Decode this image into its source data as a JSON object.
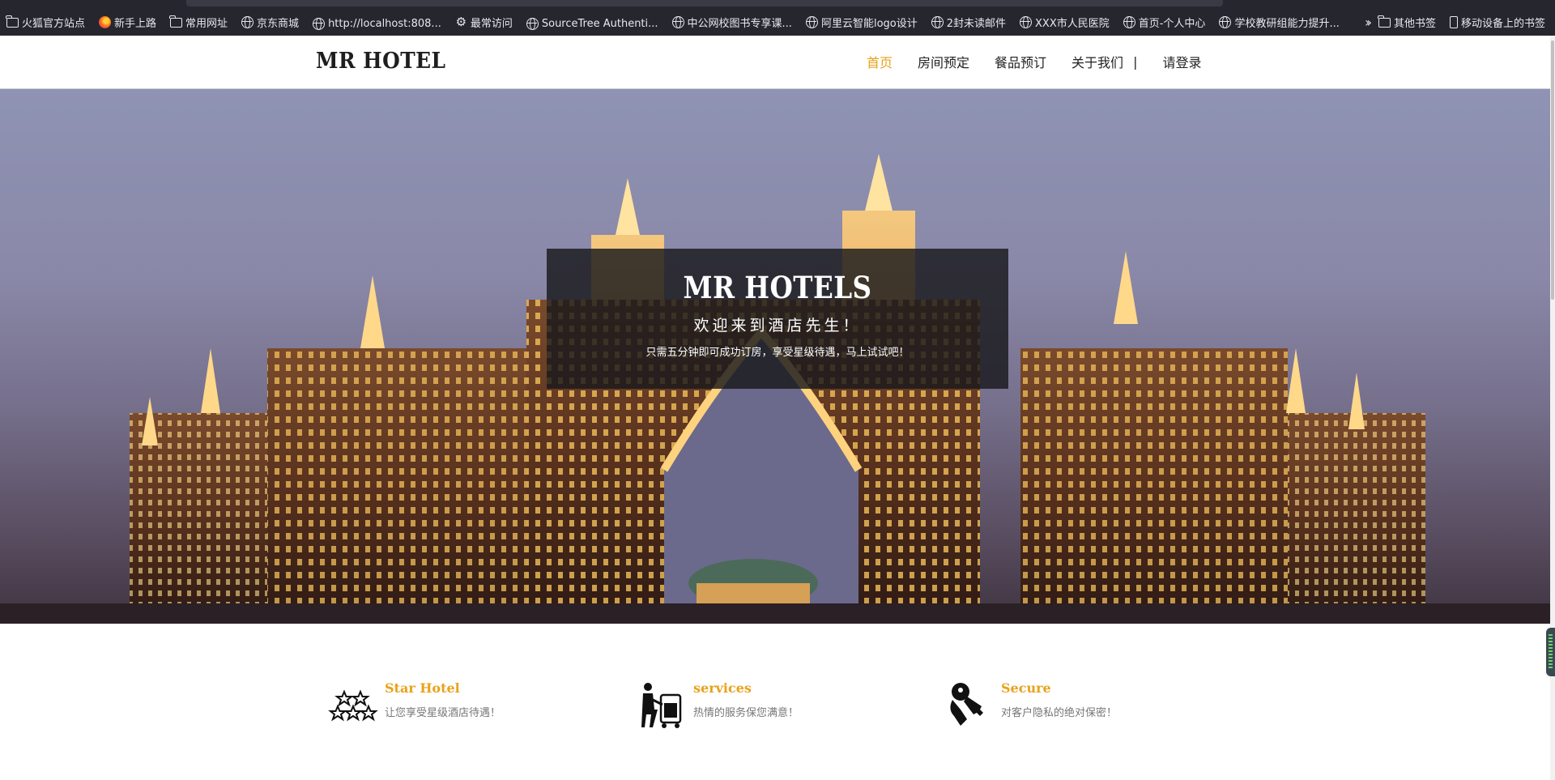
{
  "browser": {
    "bookmarks": [
      {
        "label": "火狐官方站点",
        "icon": "folder-icon"
      },
      {
        "label": "新手上路",
        "icon": "firefox-icon"
      },
      {
        "label": "常用网址",
        "icon": "folder-icon"
      },
      {
        "label": "京东商城",
        "icon": "globe-icon"
      },
      {
        "label": "http://localhost:808...",
        "icon": "globe-icon"
      },
      {
        "label": "最常访问",
        "icon": "gear-icon"
      },
      {
        "label": "SourceTree Authenti...",
        "icon": "globe-icon"
      },
      {
        "label": "中公网校图书专享课...",
        "icon": "globe-icon"
      },
      {
        "label": "阿里云智能logo设计",
        "icon": "globe-icon"
      },
      {
        "label": "2封未读邮件",
        "icon": "globe-icon"
      },
      {
        "label": "XXX市人民医院",
        "icon": "globe-icon"
      },
      {
        "label": "首页-个人中心",
        "icon": "globe-icon"
      },
      {
        "label": "学校教研组能力提升...",
        "icon": "globe-icon"
      }
    ],
    "other_bookmarks": "其他书签",
    "mobile_bookmarks": "移动设备上的书签"
  },
  "header": {
    "logo": "MR HOTEL",
    "nav": [
      {
        "label": "首页",
        "active": true
      },
      {
        "label": "房间预定",
        "active": false
      },
      {
        "label": "餐品预订",
        "active": false
      },
      {
        "label": "关于我们",
        "active": false
      }
    ],
    "separator": "|",
    "login": "请登录"
  },
  "hero": {
    "title": "MR HOTELS",
    "subtitle": "欢迎来到酒店先生！",
    "description": "只需五分钟即可成功订房，享受星级待遇，马上试试吧！"
  },
  "features": [
    {
      "title": "Star Hotel",
      "desc": "让您享受星级酒店待遇！",
      "icon": "stars-icon"
    },
    {
      "title": "services",
      "desc": "热情的服务保您满意！",
      "icon": "bellhop-icon"
    },
    {
      "title": "Secure",
      "desc": "对客户隐私的绝对保密！",
      "icon": "key-icon"
    }
  ],
  "colors": {
    "accent": "#e8a21a",
    "bookmarks_bar": "#26262f",
    "hero_box": "#19181c"
  }
}
